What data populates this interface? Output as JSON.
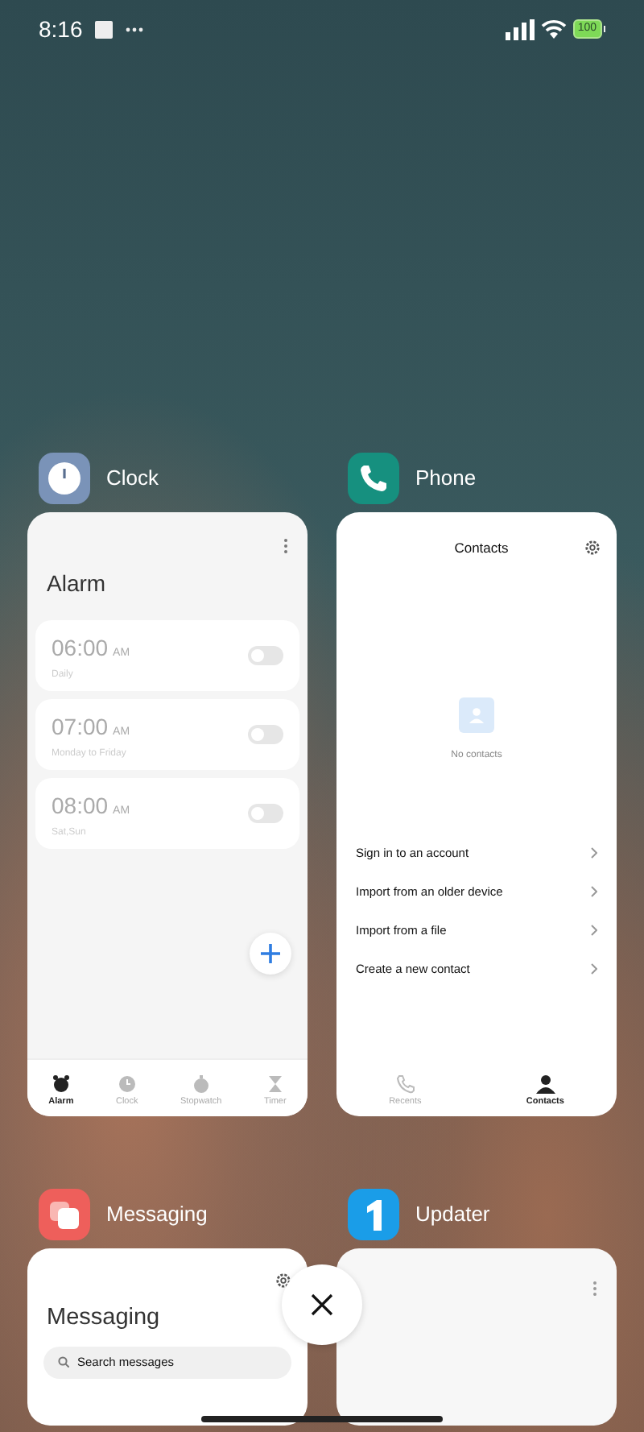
{
  "status_bar": {
    "time": "8:16",
    "battery": "100"
  },
  "apps": [
    {
      "kind": "clock",
      "name": "Clock",
      "screen": {
        "title": "Alarm",
        "alarms": [
          {
            "time": "06:00",
            "ampm": "AM",
            "repeat": "Daily",
            "on": false
          },
          {
            "time": "07:00",
            "ampm": "AM",
            "repeat": "Monday to Friday",
            "on": false
          },
          {
            "time": "08:00",
            "ampm": "AM",
            "repeat": "Sat,Sun",
            "on": false
          }
        ],
        "tabs": [
          {
            "label": "Alarm",
            "selected": true
          },
          {
            "label": "Clock",
            "selected": false
          },
          {
            "label": "Stopwatch",
            "selected": false
          },
          {
            "label": "Timer",
            "selected": false
          }
        ]
      }
    },
    {
      "kind": "phone",
      "name": "Phone",
      "screen": {
        "title": "Contacts",
        "empty_text": "No contacts",
        "actions": [
          "Sign in to an account",
          "Import from an older device",
          "Import from a file",
          "Create a new contact"
        ],
        "tabs": [
          {
            "label": "Recents",
            "selected": false
          },
          {
            "label": "Contacts",
            "selected": true
          }
        ]
      }
    },
    {
      "kind": "messaging",
      "name": "Messaging",
      "screen": {
        "title": "Messaging",
        "search_placeholder": "Search messages"
      }
    },
    {
      "kind": "updater",
      "name": "Updater"
    }
  ]
}
